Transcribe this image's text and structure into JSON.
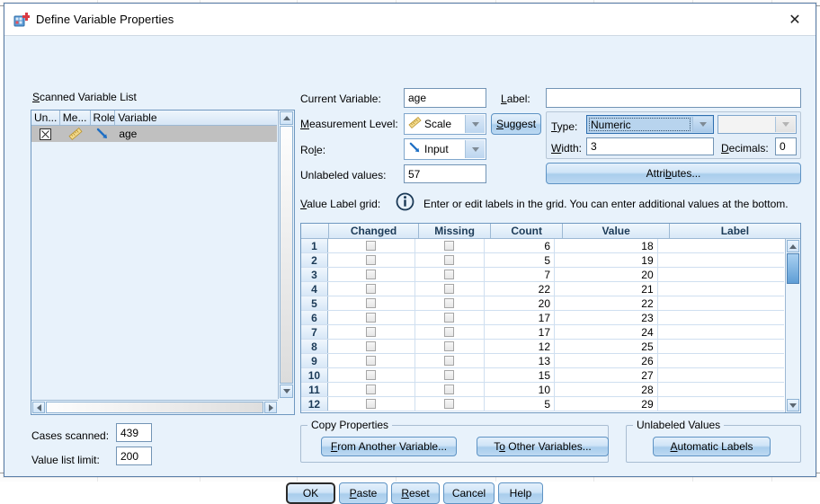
{
  "window": {
    "title": "Define Variable Properties",
    "app_icon": "spss-variable-properties-icon",
    "close_label": "✕"
  },
  "scanned_variable_list": {
    "label": "Scanned Variable List",
    "columns": [
      "Un...",
      "Me...",
      "Role",
      "Variable"
    ],
    "rows": [
      {
        "unlabeled_icon": "checkbox-x-icon",
        "measure_icon": "ruler-scale-icon",
        "role_icon": "input-arrow-icon",
        "variable": "age",
        "selected": true
      }
    ]
  },
  "properties": {
    "current_variable_label": "Current Variable:",
    "current_variable_value": "age",
    "name_label": "Label:",
    "name_value": "",
    "measurement_level_label": "Measurement Level:",
    "measurement_level_value": "Scale",
    "measurement_level_icon": "ruler-scale-icon",
    "role_label": "Role:",
    "role_value": "Input",
    "role_icon": "input-arrow-icon",
    "unlabeled_values_label": "Unlabeled values:",
    "unlabeled_values_value": "57",
    "suggest_label": "Suggest",
    "type_label": "Type:",
    "type_value": "Numeric",
    "type_format_value": "",
    "width_label": "Width:",
    "width_value": "3",
    "decimals_label": "Decimals:",
    "decimals_value": "0",
    "attributes_label": "Attributes..."
  },
  "value_label_grid": {
    "label": "Value Label grid:",
    "info_icon": "info-circle-icon",
    "hint": "Enter or edit labels in the grid. You can enter additional values at the bottom.",
    "columns": [
      "",
      "Changed",
      "Missing",
      "Count",
      "Value",
      "Label"
    ],
    "rows": [
      {
        "index": "1",
        "changed": false,
        "missing": false,
        "count": "6",
        "value": "18",
        "label": ""
      },
      {
        "index": "2",
        "changed": false,
        "missing": false,
        "count": "5",
        "value": "19",
        "label": ""
      },
      {
        "index": "3",
        "changed": false,
        "missing": false,
        "count": "7",
        "value": "20",
        "label": ""
      },
      {
        "index": "4",
        "changed": false,
        "missing": false,
        "count": "22",
        "value": "21",
        "label": ""
      },
      {
        "index": "5",
        "changed": false,
        "missing": false,
        "count": "20",
        "value": "22",
        "label": ""
      },
      {
        "index": "6",
        "changed": false,
        "missing": false,
        "count": "17",
        "value": "23",
        "label": ""
      },
      {
        "index": "7",
        "changed": false,
        "missing": false,
        "count": "17",
        "value": "24",
        "label": ""
      },
      {
        "index": "8",
        "changed": false,
        "missing": false,
        "count": "12",
        "value": "25",
        "label": ""
      },
      {
        "index": "9",
        "changed": false,
        "missing": false,
        "count": "13",
        "value": "26",
        "label": ""
      },
      {
        "index": "10",
        "changed": false,
        "missing": false,
        "count": "15",
        "value": "27",
        "label": ""
      },
      {
        "index": "11",
        "changed": false,
        "missing": false,
        "count": "10",
        "value": "28",
        "label": ""
      },
      {
        "index": "12",
        "changed": false,
        "missing": false,
        "count": "5",
        "value": "29",
        "label": ""
      }
    ]
  },
  "footer": {
    "cases_scanned_label": "Cases scanned:",
    "cases_scanned_value": "439",
    "value_list_limit_label": "Value list limit:",
    "value_list_limit_value": "200",
    "copy_properties_legend": "Copy Properties",
    "from_another_variable_label": "From Another Variable...",
    "to_other_variables_label": "To Other Variables...",
    "unlabeled_values_legend": "Unlabeled Values",
    "automatic_labels_label": "Automatic Labels"
  },
  "actions": {
    "ok": "OK",
    "paste": "Paste",
    "reset": "Reset",
    "cancel": "Cancel",
    "help": "Help"
  },
  "colors": {
    "dialog_bg": "#e8f2fb",
    "accent": "#3b7cc0",
    "field_border": "#7294b5",
    "selected_row": "#c0c0c0"
  }
}
